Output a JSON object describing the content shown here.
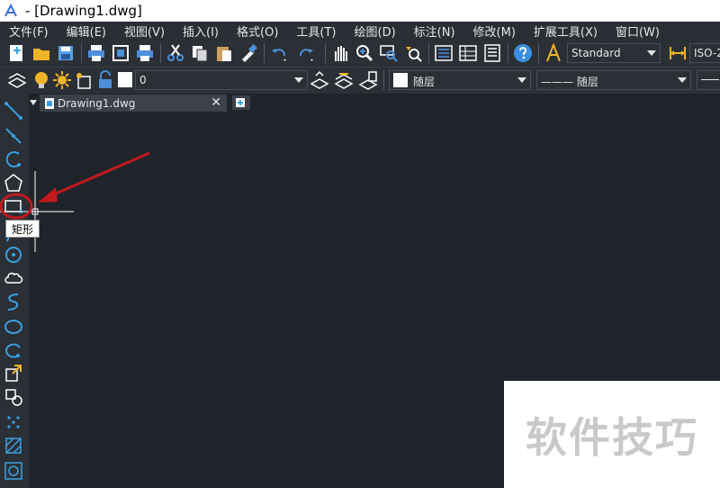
{
  "window": {
    "title": "- [Drawing1.dwg]"
  },
  "menu": {
    "items": [
      "文件(F)",
      "编辑(E)",
      "视图(V)",
      "插入(I)",
      "格式(O)",
      "工具(T)",
      "绘图(D)",
      "标注(N)",
      "修改(M)",
      "扩展工具(X)",
      "窗口(W)"
    ]
  },
  "toolbar": {
    "text_style": "Standard",
    "dim_style": "ISO-2",
    "layer": "0",
    "color": "随层",
    "linetype": "——— 随层"
  },
  "tab": {
    "name": "Drawing1.dwg"
  },
  "tooltip": {
    "text": "矩形"
  },
  "watermark": {
    "text": "软件技巧"
  },
  "colors": {
    "accent": "#3aa0e0",
    "annotation_red": "#c0191e",
    "icon_yellow": "#f0b428"
  }
}
